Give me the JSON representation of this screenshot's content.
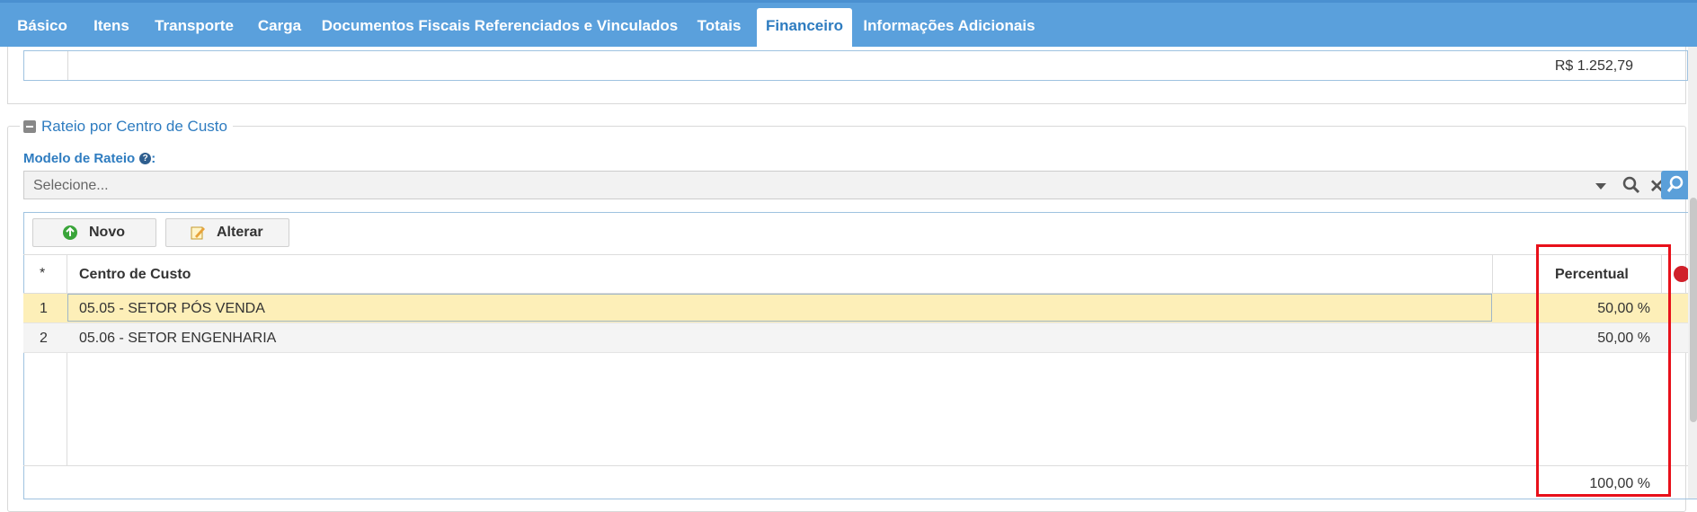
{
  "tabs": [
    {
      "label": "Básico"
    },
    {
      "label": "Itens"
    },
    {
      "label": "Transporte"
    },
    {
      "label": "Carga"
    },
    {
      "label": "Documentos Fiscais Referenciados e Vinculados"
    },
    {
      "label": "Totais"
    },
    {
      "label": "Financeiro",
      "active": true
    },
    {
      "label": "Informações Adicionais"
    }
  ],
  "top_total": "R$ 1.252,79",
  "section": {
    "title": "Rateio por Centro de Custo"
  },
  "modelo": {
    "label": "Modelo de Rateio",
    "colon": ":",
    "placeholder": "Selecione..."
  },
  "toolbar": {
    "novo": "Novo",
    "alterar": "Alterar"
  },
  "table": {
    "headers": {
      "index": "*",
      "centro": "Centro de Custo",
      "percentual": "Percentual"
    },
    "rows": [
      {
        "n": "1",
        "centro": "05.05 - SETOR PÓS VENDA",
        "percentual": "50,00 %"
      },
      {
        "n": "2",
        "centro": "05.06 - SETOR ENGENHARIA",
        "percentual": "50,00 %"
      }
    ],
    "total": "100,00 %"
  },
  "colors": {
    "tab_bar": "#5aa0dc",
    "accent": "#2e7cc0",
    "selected_row": "#fdefb8",
    "highlight": "#e8101a"
  }
}
